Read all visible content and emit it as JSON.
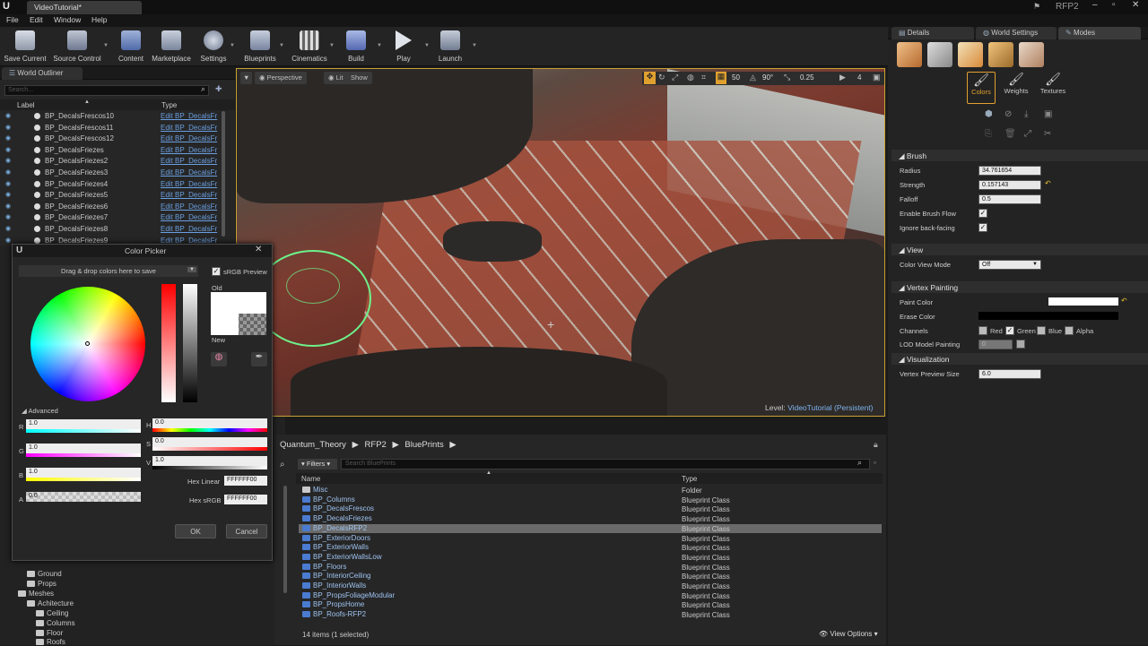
{
  "window": {
    "title": "VideoTutorial*",
    "project": "RFP2"
  },
  "menu": [
    "File",
    "Edit",
    "Window",
    "Help"
  ],
  "toolbar": [
    {
      "label": "Save Current",
      "icon": "save-icon"
    },
    {
      "label": "Source Control",
      "icon": "source-control-icon"
    },
    {
      "label": "Content",
      "icon": "content-icon"
    },
    {
      "label": "Marketplace",
      "icon": "marketplace-icon"
    },
    {
      "label": "Settings",
      "icon": "settings-icon"
    },
    {
      "label": "Blueprints",
      "icon": "blueprints-icon"
    },
    {
      "label": "Cinematics",
      "icon": "cinematics-icon"
    },
    {
      "label": "Build",
      "icon": "build-icon"
    },
    {
      "label": "Play",
      "icon": "play-icon"
    },
    {
      "label": "Launch",
      "icon": "launch-icon"
    }
  ],
  "outliner": {
    "tab": "World Outliner",
    "search_placeholder": "Search...",
    "col_label": "Label",
    "col_type": "Type",
    "rows": [
      {
        "label": "BP_DecalsFrescos10",
        "type": "Edit BP_DecalsFr"
      },
      {
        "label": "BP_DecalsFrescos11",
        "type": "Edit BP_DecalsFr"
      },
      {
        "label": "BP_DecalsFrescos12",
        "type": "Edit BP_DecalsFr"
      },
      {
        "label": "BP_DecalsFriezes",
        "type": "Edit BP_DecalsFr"
      },
      {
        "label": "BP_DecalsFriezes2",
        "type": "Edit BP_DecalsFr"
      },
      {
        "label": "BP_DecalsFriezes3",
        "type": "Edit BP_DecalsFr"
      },
      {
        "label": "BP_DecalsFriezes4",
        "type": "Edit BP_DecalsFr"
      },
      {
        "label": "BP_DecalsFriezes5",
        "type": "Edit BP_DecalsFr"
      },
      {
        "label": "BP_DecalsFriezes6",
        "type": "Edit BP_DecalsFr"
      },
      {
        "label": "BP_DecalsFriezes7",
        "type": "Edit BP_DecalsFr"
      },
      {
        "label": "BP_DecalsFriezes8",
        "type": "Edit BP_DecalsFr"
      },
      {
        "label": "BP_DecalsFriezes9",
        "type": "Edit BP_DecalsFr"
      }
    ]
  },
  "viewport": {
    "perspective": "Perspective",
    "lit": "Lit",
    "show": "Show",
    "grid_snap": "50",
    "rot_snap": "90°",
    "scale_snap": "0.25",
    "cam_speed": "4",
    "level_label": "Level:",
    "level_name": "VideoTutorial (Persistent)"
  },
  "color_picker": {
    "title": "Color Picker",
    "drag_text": "Drag & drop colors here to save",
    "srgb_preview": "sRGB Preview",
    "old": "Old",
    "new": "New",
    "advanced": "Advanced",
    "r_label": "R",
    "r": "1.0",
    "g_label": "G",
    "g": "1.0",
    "b_label": "B",
    "b": "1.0",
    "a_label": "A",
    "a": "0.0",
    "h_label": "H",
    "h": "0.0",
    "s_label": "S",
    "s": "0.0",
    "v_label": "V",
    "v": "1.0",
    "hex_linear_label": "Hex Linear",
    "hex_linear": "FFFFFF00",
    "hex_srgb_label": "Hex sRGB",
    "hex_srgb": "FFFFFF00",
    "ok": "OK",
    "cancel": "Cancel"
  },
  "content_browser": {
    "breadcrumb": [
      "Quantum_Theory",
      "RFP2",
      "BluePrints"
    ],
    "filters": "Filters",
    "search_placeholder": "Search BluePrints",
    "col_name": "Name",
    "col_type": "Type",
    "items": [
      {
        "name": "Misc",
        "type": "Folder"
      },
      {
        "name": "BP_Columns",
        "type": "Blueprint Class"
      },
      {
        "name": "BP_DecalsFrescos",
        "type": "Blueprint Class"
      },
      {
        "name": "BP_DecalsFriezes",
        "type": "Blueprint Class"
      },
      {
        "name": "BP_DecalsRFP2",
        "type": "Blueprint Class"
      },
      {
        "name": "BP_ExteriorDoors",
        "type": "Blueprint Class"
      },
      {
        "name": "BP_ExteriorWalls",
        "type": "Blueprint Class"
      },
      {
        "name": "BP_ExteriorWallsLow",
        "type": "Blueprint Class"
      },
      {
        "name": "BP_Floors",
        "type": "Blueprint Class"
      },
      {
        "name": "BP_InteriorCeiling",
        "type": "Blueprint Class"
      },
      {
        "name": "BP_InteriorWalls",
        "type": "Blueprint Class"
      },
      {
        "name": "BP_PropsFoliageModular",
        "type": "Blueprint Class"
      },
      {
        "name": "BP_PropsHome",
        "type": "Blueprint Class"
      },
      {
        "name": "BP_Roofs-RFP2",
        "type": "Blueprint Class"
      }
    ],
    "status": "14 items (1 selected)",
    "view_options": "View Options"
  },
  "folder_tree": [
    {
      "label": "Ground",
      "indent": 2
    },
    {
      "label": "Props",
      "indent": 2
    },
    {
      "label": "Meshes",
      "indent": 1
    },
    {
      "label": "Achitecture",
      "indent": 2
    },
    {
      "label": "Ceiling",
      "indent": 3
    },
    {
      "label": "Columns",
      "indent": 3
    },
    {
      "label": "Floor",
      "indent": 3
    },
    {
      "label": "Roofs",
      "indent": 3
    }
  ],
  "right_panel": {
    "tabs": [
      "Details",
      "World Settings",
      "Modes"
    ],
    "paint_modes": [
      "Colors",
      "Weights",
      "Textures"
    ],
    "brush": {
      "title": "Brush",
      "radius_label": "Radius",
      "radius": "34.761654",
      "strength_label": "Strength",
      "strength": "0.157143",
      "falloff_label": "Falloff",
      "falloff": "0.5",
      "flow_label": "Enable Brush Flow",
      "backface_label": "Ignore back-facing"
    },
    "view": {
      "title": "View",
      "mode_label": "Color View Mode",
      "mode": "Off"
    },
    "vertex": {
      "title": "Vertex Painting",
      "paint_color_label": "Paint Color",
      "erase_color_label": "Erase Color",
      "channels_label": "Channels",
      "red": "Red",
      "green": "Green",
      "blue": "Blue",
      "alpha": "Alpha",
      "lod_label": "LOD Model Painting",
      "lod": "0"
    },
    "visualization": {
      "title": "Visualization",
      "size_label": "Vertex Preview Size",
      "size": "6.0"
    }
  }
}
